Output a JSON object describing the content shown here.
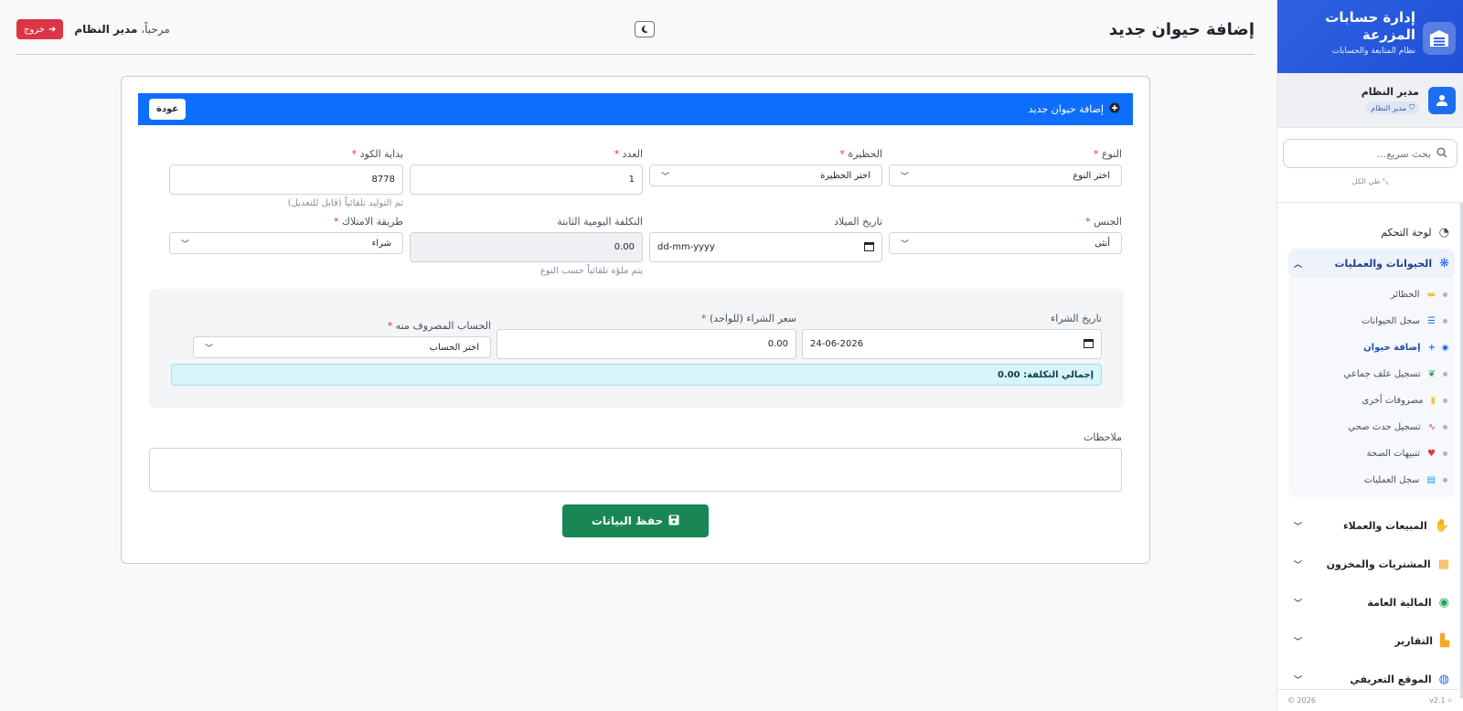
{
  "brand": {
    "title": "إدارة حسابات المزرعة",
    "subtitle": "نظام المتابعة والحسابات"
  },
  "user": {
    "name": "مدير النظام",
    "role": "مدير النظام"
  },
  "sidebar_search": {
    "placeholder": "بحث سريع...",
    "collapse_all": "طي الكل"
  },
  "nav": {
    "dashboard": "لوحة التحكم",
    "animals_group": "الحيوانات والعمليات",
    "sub_items": [
      {
        "label": "الحظائر",
        "icon": "barn-icon",
        "color": "#f5c542"
      },
      {
        "label": "سجل الحيوانات",
        "icon": "list-icon",
        "color": "#1e6ff0"
      },
      {
        "label": "إضافة حيوان",
        "icon": "plus-icon",
        "color": "#1e6ff0"
      },
      {
        "label": "تسجيل علف جماعي",
        "icon": "seedling-icon",
        "color": "#22a55a"
      },
      {
        "label": "مصروفات أخرى",
        "icon": "receipt-icon",
        "color": "#f5c542"
      },
      {
        "label": "تسجيل حدث صحي",
        "icon": "stethoscope-icon",
        "color": "#dc3545"
      },
      {
        "label": "تنبيهات الصحة",
        "icon": "heart-icon",
        "color": "#dc3545"
      },
      {
        "label": "سجل العمليات",
        "icon": "clipboard-icon",
        "color": "#17a2d8"
      }
    ],
    "groups": [
      {
        "label": "المبيعات والعملاء",
        "icon": "handshake-icon",
        "color": "#22a55a"
      },
      {
        "label": "المشتريات والمخزون",
        "icon": "boxes-icon",
        "color": "#f5a623"
      },
      {
        "label": "المالية العامة",
        "icon": "coins-icon",
        "color": "#22a55a"
      },
      {
        "label": "التقارير",
        "icon": "chart-icon",
        "color": "#f5a623"
      },
      {
        "label": "الموقع التعريفي",
        "icon": "globe-icon",
        "color": "#1e6ff0"
      }
    ]
  },
  "footer": {
    "version": "v2.1",
    "year": "2026 ©"
  },
  "topbar": {
    "page_title": "إضافة حيوان جديد",
    "welcome": "مرحباً،",
    "welcome_name": "مدير النظام",
    "logout": "خروج"
  },
  "card": {
    "header": "إضافة حيوان جديد",
    "back": "عودة"
  },
  "form": {
    "type": {
      "label": "النوع",
      "value": "اختر النوع"
    },
    "barn": {
      "label": "الحظيرة",
      "value": "اختر الحظيرة"
    },
    "count": {
      "label": "العدد",
      "value": "1"
    },
    "code_start": {
      "label": "بداية الكود",
      "value": "8778",
      "hint": "تم التوليد تلقائياً (قابل للتعديل)"
    },
    "gender": {
      "label": "الجنس",
      "value": "أنثى"
    },
    "birth_date": {
      "label": "تاريخ الميلاد",
      "value": "dd-mm-yyyy"
    },
    "daily_cost": {
      "label": "التكلفة اليومية الثابتة",
      "value": "0.00",
      "hint": "يتم ملؤه تلقائياً حسب النوع"
    },
    "ownership": {
      "label": "طريقة الامتلاك",
      "value": "شراء"
    },
    "purchase_date": {
      "label": "تاريخ الشراء",
      "value": "24-06-2026"
    },
    "purchase_price": {
      "label": "سعر الشراء (للواحد)",
      "value": "0.00"
    },
    "account": {
      "label": "الحساب المصروف منه",
      "value": "اختر الحساب"
    },
    "total": "إجمالي التكلفة: 0.00",
    "notes": {
      "label": "ملاحظات"
    },
    "save": "حفظ البيانات"
  }
}
